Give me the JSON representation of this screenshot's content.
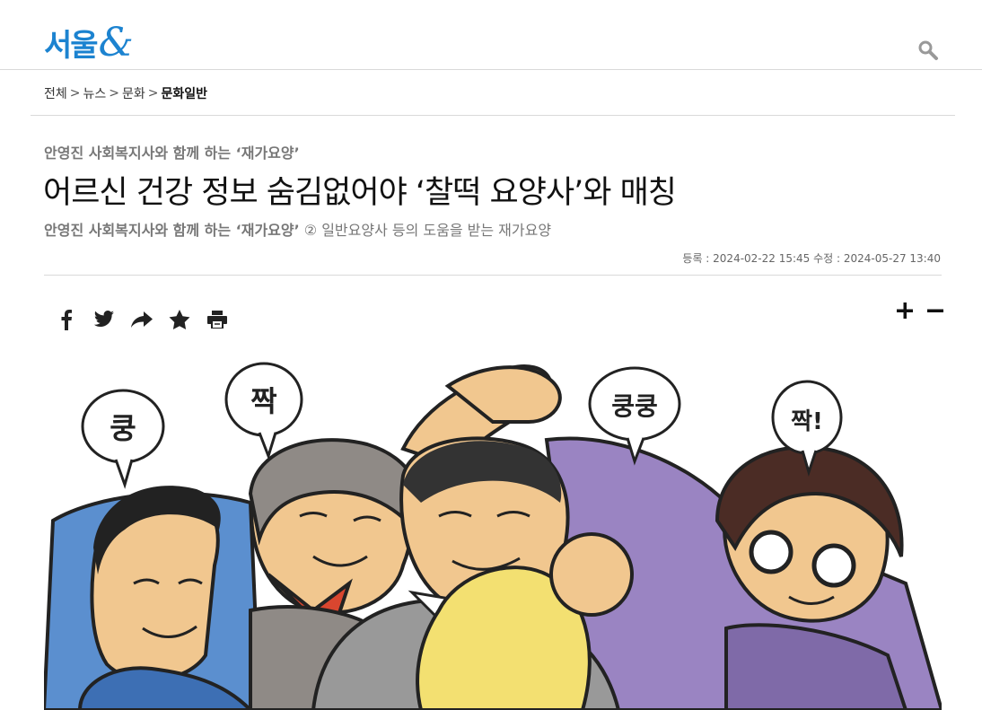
{
  "header": {
    "logo_text": "서울",
    "logo_amp": "&",
    "search_icon": "search-icon"
  },
  "breadcrumb": {
    "items": [
      "전체",
      "뉴스",
      "문화"
    ],
    "current": "문화일반",
    "separator": ">"
  },
  "article": {
    "series": "안영진 사회복지사와 함께 하는 ‘재가요양’",
    "title": "어르신 건강 정보 숨김없어야 ‘찰떡 요양사’와 매칭",
    "subtitle_bold": "안영진 사회복지사와 함께 하는 ‘재가요양’",
    "subtitle_rest": " ② 일반요양사 등의 도움을 받는 재가요양",
    "dates": "등록 : 2024-02-22 15:45 수정 : 2024-05-27 13:40"
  },
  "share": {
    "icons": [
      "facebook-icon",
      "twitter-icon",
      "share-icon",
      "star-icon",
      "print-icon"
    ]
  },
  "fontsize": {
    "icons": [
      "plus-icon",
      "minus-icon"
    ]
  },
  "illustration": {
    "bubbles": [
      "쿵",
      "짝",
      "쿵쿵",
      "짝!"
    ]
  },
  "colors": {
    "brand": "#1c83d0",
    "text": "#111111",
    "muted": "#777777"
  }
}
